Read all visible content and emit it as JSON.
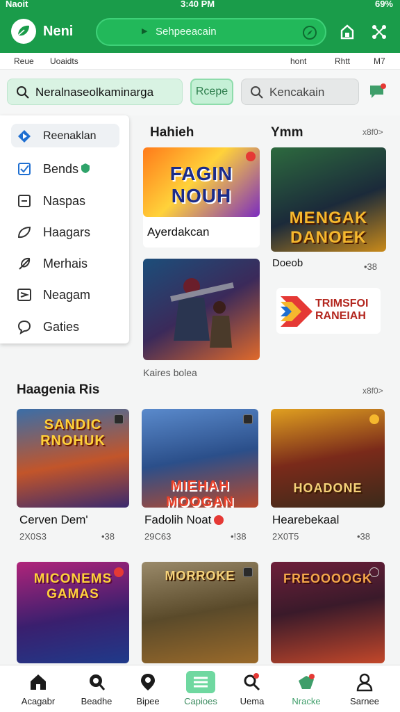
{
  "status": {
    "left": "Naoit",
    "time": "3:40 PM",
    "battery": "69%"
  },
  "header": {
    "app_name": "Neni",
    "search_text": "Sehpeeacain",
    "subnav": [
      "Reue",
      "Uoaidts",
      "hont",
      "Rhtt",
      "M7"
    ]
  },
  "search": {
    "main_value": "Neralnaseolkaminarga",
    "recipe_button": "Rcepe",
    "secondary_value": "Kencakain"
  },
  "menu": {
    "items": [
      {
        "label": "Reenaklan",
        "icon": "play-diamond-icon"
      },
      {
        "label": "Bends",
        "icon": "checkbox-icon"
      },
      {
        "label": "Naspas",
        "icon": "square-minus-icon"
      },
      {
        "label": "Haagars",
        "icon": "leaf-icon"
      },
      {
        "label": "Merhais",
        "icon": "feather-icon"
      },
      {
        "label": "Neagam",
        "icon": "send-box-icon"
      },
      {
        "label": "Gaties",
        "icon": "chat-bubble-icon"
      }
    ]
  },
  "section1": {
    "left_title": "Hahieh",
    "right_title": "Ymm",
    "right_more": "x8f0>",
    "cards": [
      {
        "art": "FAGIN NOUH",
        "title": "Ayerdakcan",
        "colors": [
          "#ff7a1a",
          "#7b2cbf"
        ]
      },
      {
        "art": "MENGAK DANOEK",
        "title": "Doeob",
        "meta": "•38",
        "colors": [
          "#2d6a3e",
          "#c98a1a"
        ]
      },
      {
        "art": "",
        "caption": "Kaires bolea",
        "colors": [
          "#1c4e7a",
          "#e06a2b"
        ]
      },
      {
        "art": "TRIMSFOI RANEIAH",
        "colors": [
          "#ffffff",
          "#ffffff"
        ]
      }
    ]
  },
  "section2": {
    "title": "Haagenia Ris",
    "more": "x8f0>",
    "cards": [
      {
        "art": "SANDIC RNOHUK",
        "title": "Cerven Dem'",
        "meta_left": "2X0S3",
        "meta_right": "•38",
        "colors": [
          "#c2552a",
          "#3a2a6e"
        ]
      },
      {
        "art": "MIEHAH MOOGAN",
        "title": "Fadolih Noat",
        "meta_left": "29C63",
        "meta_right": "•!38",
        "colors": [
          "#2b4f8a",
          "#b8492c"
        ]
      },
      {
        "art": "HOADONE",
        "title": "Hearebekaal",
        "meta_left": "2X0T5",
        "meta_right": "•38",
        "colors": [
          "#e0a020",
          "#3b2a1a"
        ]
      },
      {
        "art": "MICONEMS GAMAS",
        "title": "",
        "colors": [
          "#b0247a",
          "#3a1f6e"
        ]
      },
      {
        "art": "MORROKE",
        "title": "",
        "colors": [
          "#5a4a2a",
          "#9a6a2a"
        ]
      },
      {
        "art": "FREOOOOGK",
        "title": "",
        "colors": [
          "#6e1f3a",
          "#c2472a"
        ]
      }
    ]
  },
  "bottom_nav": [
    {
      "label": "Acagabr",
      "icon": "home-icon"
    },
    {
      "label": "Beadhe",
      "icon": "search-pin-icon"
    },
    {
      "label": "Bipee",
      "icon": "location-pin-icon"
    },
    {
      "label": "Capioes",
      "icon": "list-icon",
      "active": true
    },
    {
      "label": "Uema",
      "icon": "search-person-icon"
    },
    {
      "label": "Nracke",
      "icon": "ticket-icon"
    },
    {
      "label": "Sarnee",
      "icon": "profile-icon"
    }
  ],
  "colors": {
    "brand": "#1a9c4a",
    "accent": "#6fd8a0"
  }
}
